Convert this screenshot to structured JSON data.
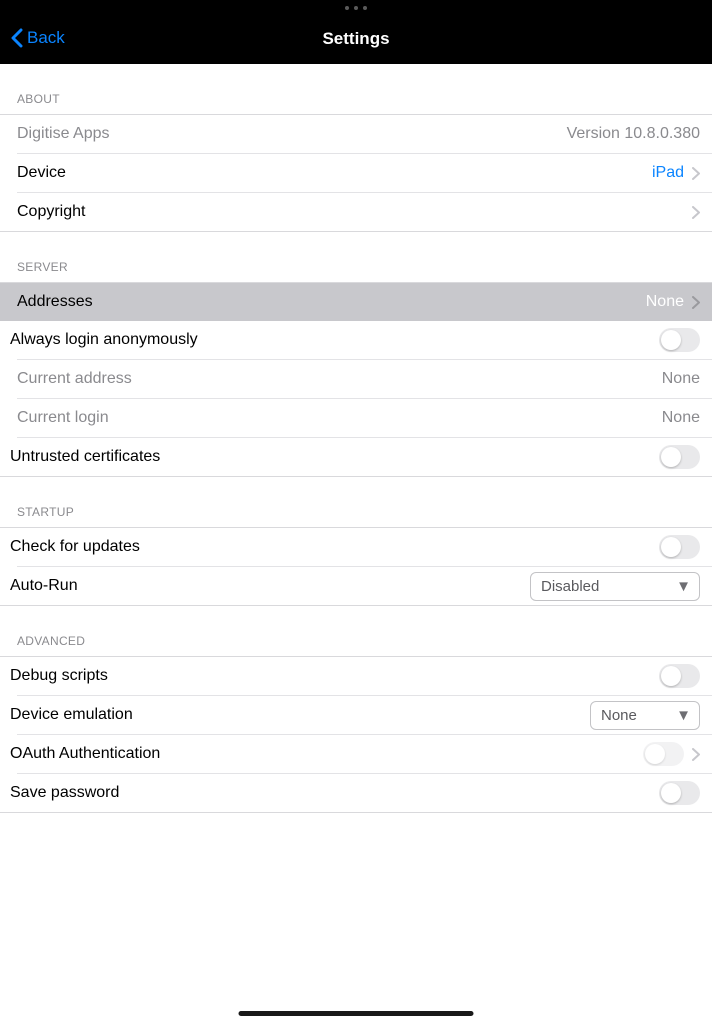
{
  "nav": {
    "back": "Back",
    "title": "Settings"
  },
  "about": {
    "header": "ABOUT",
    "app_label": "Digitise Apps",
    "app_version": "Version 10.8.0.380",
    "device_label": "Device",
    "device_value": "iPad",
    "copyright_label": "Copyright"
  },
  "server": {
    "header": "SERVER",
    "addresses_label": "Addresses",
    "addresses_value": "None",
    "anon_label": "Always login anonymously",
    "curr_addr_label": "Current address",
    "curr_addr_value": "None",
    "curr_login_label": "Current login",
    "curr_login_value": "None",
    "untrusted_label": "Untrusted certificates"
  },
  "startup": {
    "header": "STARTUP",
    "updates_label": "Check for updates",
    "autorun_label": "Auto-Run",
    "autorun_value": "Disabled"
  },
  "advanced": {
    "header": "ADVANCED",
    "debug_label": "Debug scripts",
    "emulation_label": "Device emulation",
    "emulation_value": "None",
    "oauth_label": "OAuth Authentication",
    "savepw_label": "Save password"
  }
}
